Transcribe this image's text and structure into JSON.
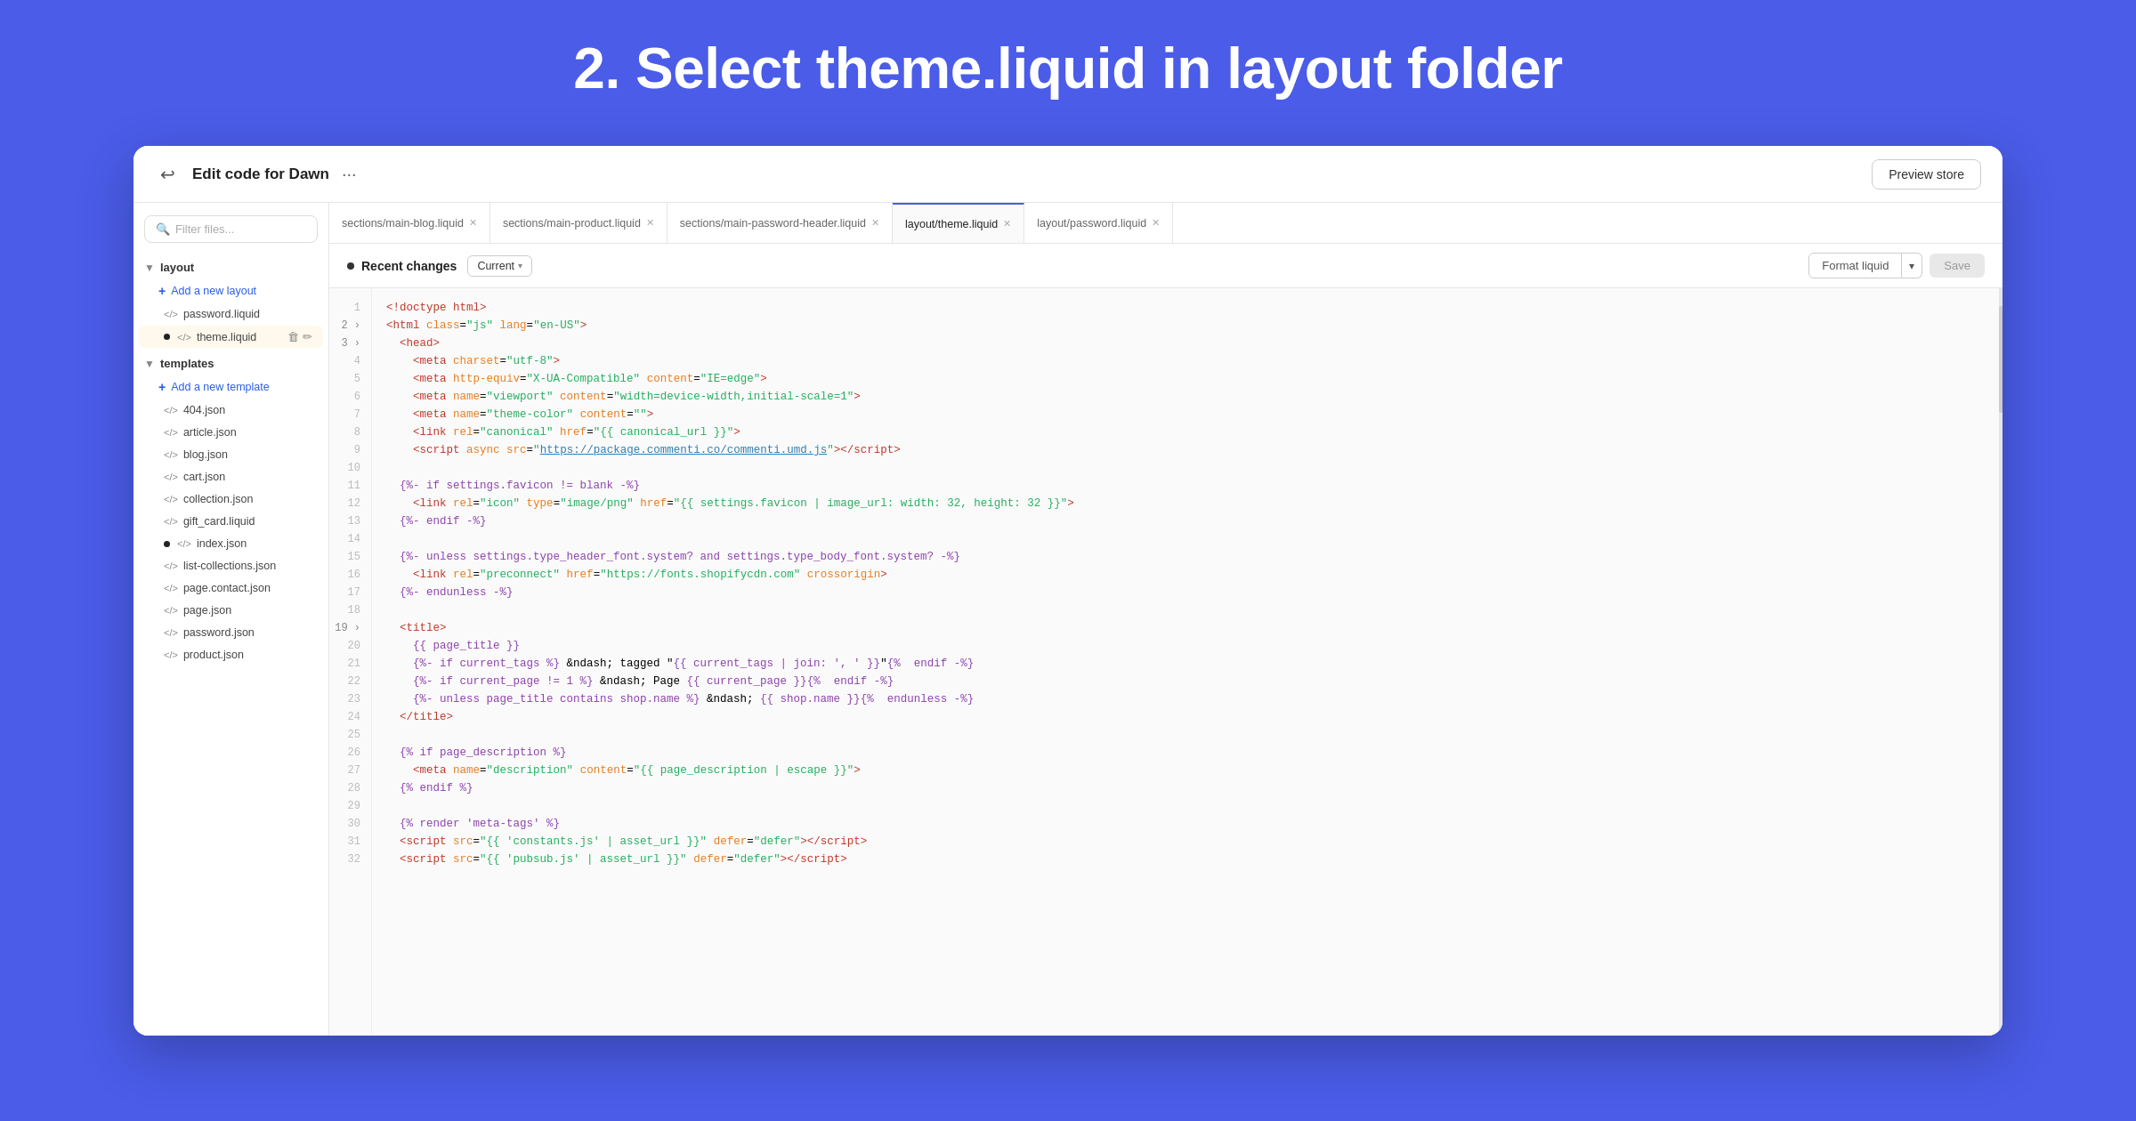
{
  "heading": "2.  Select theme.liquid in layout folder",
  "topbar": {
    "title": "Edit code for Dawn",
    "preview_btn": "Preview store"
  },
  "filter_placeholder": "Filter files...",
  "sidebar": {
    "layout_folder": "layout",
    "add_layout": "Add a new layout",
    "layout_files": [
      {
        "name": "password.liquid",
        "active": false,
        "dot": false
      },
      {
        "name": "theme.liquid",
        "active": true,
        "dot": true
      }
    ],
    "templates_folder": "templates",
    "add_template": "Add a new template",
    "template_files": [
      {
        "name": "404.json"
      },
      {
        "name": "article.json"
      },
      {
        "name": "blog.json"
      },
      {
        "name": "cart.json"
      },
      {
        "name": "collection.json"
      },
      {
        "name": "gift_card.liquid"
      },
      {
        "name": "index.json",
        "dot": true
      },
      {
        "name": "list-collections.json"
      },
      {
        "name": "page.contact.json"
      },
      {
        "name": "page.json"
      },
      {
        "name": "password.json"
      },
      {
        "name": "product.json"
      }
    ]
  },
  "tabs": [
    {
      "label": "sections/main-blog.liquid",
      "active": false
    },
    {
      "label": "sections/main-product.liquid",
      "active": false
    },
    {
      "label": "sections/main-password-header.liquid",
      "active": false
    },
    {
      "label": "layout/theme.liquid",
      "active": true
    },
    {
      "label": "layout/password.liquid",
      "active": false
    }
  ],
  "toolbar": {
    "recent_changes": "Recent changes",
    "current": "Current",
    "format_liquid": "Format liquid",
    "save": "Save"
  },
  "code_lines": [
    {
      "num": "1",
      "chevron": false,
      "code": "<!doctype html>"
    },
    {
      "num": "2",
      "chevron": true,
      "code": "<html class=\"js\" lang=\"en-US\">"
    },
    {
      "num": "3",
      "chevron": true,
      "code": "  <head>"
    },
    {
      "num": "4",
      "chevron": false,
      "code": "    <meta charset=\"utf-8\">"
    },
    {
      "num": "5",
      "chevron": false,
      "code": "    <meta http-equiv=\"X-UA-Compatible\" content=\"IE=edge\">"
    },
    {
      "num": "6",
      "chevron": false,
      "code": "    <meta name=\"viewport\" content=\"width=device-width,initial-scale=1\">"
    },
    {
      "num": "7",
      "chevron": false,
      "code": "    <meta name=\"theme-color\" content=\"\">"
    },
    {
      "num": "8",
      "chevron": false,
      "code": "    <link rel=\"canonical\" href=\"{{ canonical_url }}\">"
    },
    {
      "num": "9",
      "chevron": false,
      "code": "    <script async src=\"https://package.commenti.co/commenti.umd.js\"></script>"
    },
    {
      "num": "10",
      "chevron": false,
      "code": ""
    },
    {
      "num": "11",
      "chevron": false,
      "code": "  {%- if settings.favicon != blank -%}"
    },
    {
      "num": "12",
      "chevron": false,
      "code": "    <link rel=\"icon\" type=\"image/png\" href=\"{{ settings.favicon | image_url: width: 32, height: 32 }}\">"
    },
    {
      "num": "13",
      "chevron": false,
      "code": "  {%- endif -%}"
    },
    {
      "num": "14",
      "chevron": false,
      "code": ""
    },
    {
      "num": "15",
      "chevron": false,
      "code": "  {%- unless settings.type_header_font.system? and settings.type_body_font.system? -%}"
    },
    {
      "num": "16",
      "chevron": false,
      "code": "    <link rel=\"preconnect\" href=\"https://fonts.shopifycdn.com\" crossorigin>"
    },
    {
      "num": "17",
      "chevron": false,
      "code": "  {%- endunless -%}"
    },
    {
      "num": "18",
      "chevron": false,
      "code": ""
    },
    {
      "num": "19",
      "chevron": true,
      "code": "  <title>"
    },
    {
      "num": "20",
      "chevron": false,
      "code": "    {{ page_title }}"
    },
    {
      "num": "21",
      "chevron": false,
      "code": "    {%- if current_tags %} &ndash; tagged \"{{ current_tags | join: ', ' }}\"{%  endif -%}"
    },
    {
      "num": "22",
      "chevron": false,
      "code": "    {%- if current_page != 1 %} &ndash; Page {{ current_page }}{%  endif -%}"
    },
    {
      "num": "23",
      "chevron": false,
      "code": "    {%- unless page_title contains shop.name %} &ndash; {{ shop.name }}{%  endunless -%}"
    },
    {
      "num": "24",
      "chevron": false,
      "code": "  </title>"
    },
    {
      "num": "25",
      "chevron": false,
      "code": ""
    },
    {
      "num": "26",
      "chevron": false,
      "code": "  {% if page_description %}"
    },
    {
      "num": "27",
      "chevron": false,
      "code": "    <meta name=\"description\" content=\"{{ page_description | escape }}\">"
    },
    {
      "num": "28",
      "chevron": false,
      "code": "  {% endif %}"
    },
    {
      "num": "29",
      "chevron": false,
      "code": ""
    },
    {
      "num": "30",
      "chevron": false,
      "code": "  {% render 'meta-tags' %}"
    },
    {
      "num": "31",
      "chevron": false,
      "code": "  <script src=\"{{ 'constants.js' | asset_url }}\" defer=\"defer\"></script>"
    },
    {
      "num": "32",
      "chevron": false,
      "code": "  <script src=\"{{ 'pubsub.js' | asset_url }}\" defer=\"defer\"></script>"
    }
  ]
}
